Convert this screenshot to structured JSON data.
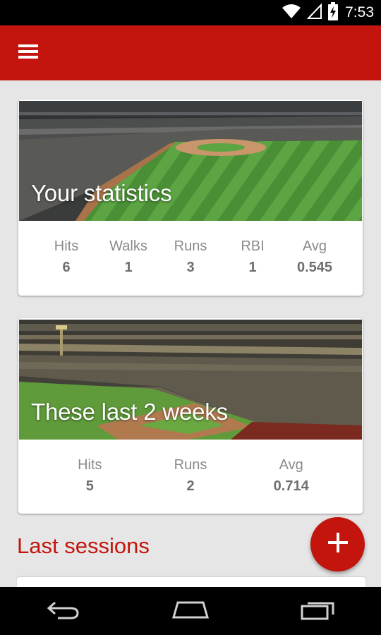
{
  "status_bar": {
    "time": "7:53"
  },
  "app_bar": {
    "menu_icon": "hamburger-menu-icon",
    "color": "#c3140d"
  },
  "cards": [
    {
      "title": "Your statistics",
      "stats": [
        {
          "label": "Hits",
          "value": "6"
        },
        {
          "label": "Walks",
          "value": "1"
        },
        {
          "label": "Runs",
          "value": "3"
        },
        {
          "label": "RBI",
          "value": "1"
        },
        {
          "label": "Avg",
          "value": "0.545"
        }
      ]
    },
    {
      "title": "These last 2 weeks",
      "stats": [
        {
          "label": "Hits",
          "value": "5"
        },
        {
          "label": "Runs",
          "value": "2"
        },
        {
          "label": "Avg",
          "value": "0.714"
        }
      ]
    }
  ],
  "sections": {
    "last_sessions": "Last sessions"
  },
  "fab": {
    "icon": "plus-icon"
  },
  "nav_bar": {
    "icons": [
      "back-icon",
      "home-icon",
      "recent-apps-icon"
    ]
  }
}
